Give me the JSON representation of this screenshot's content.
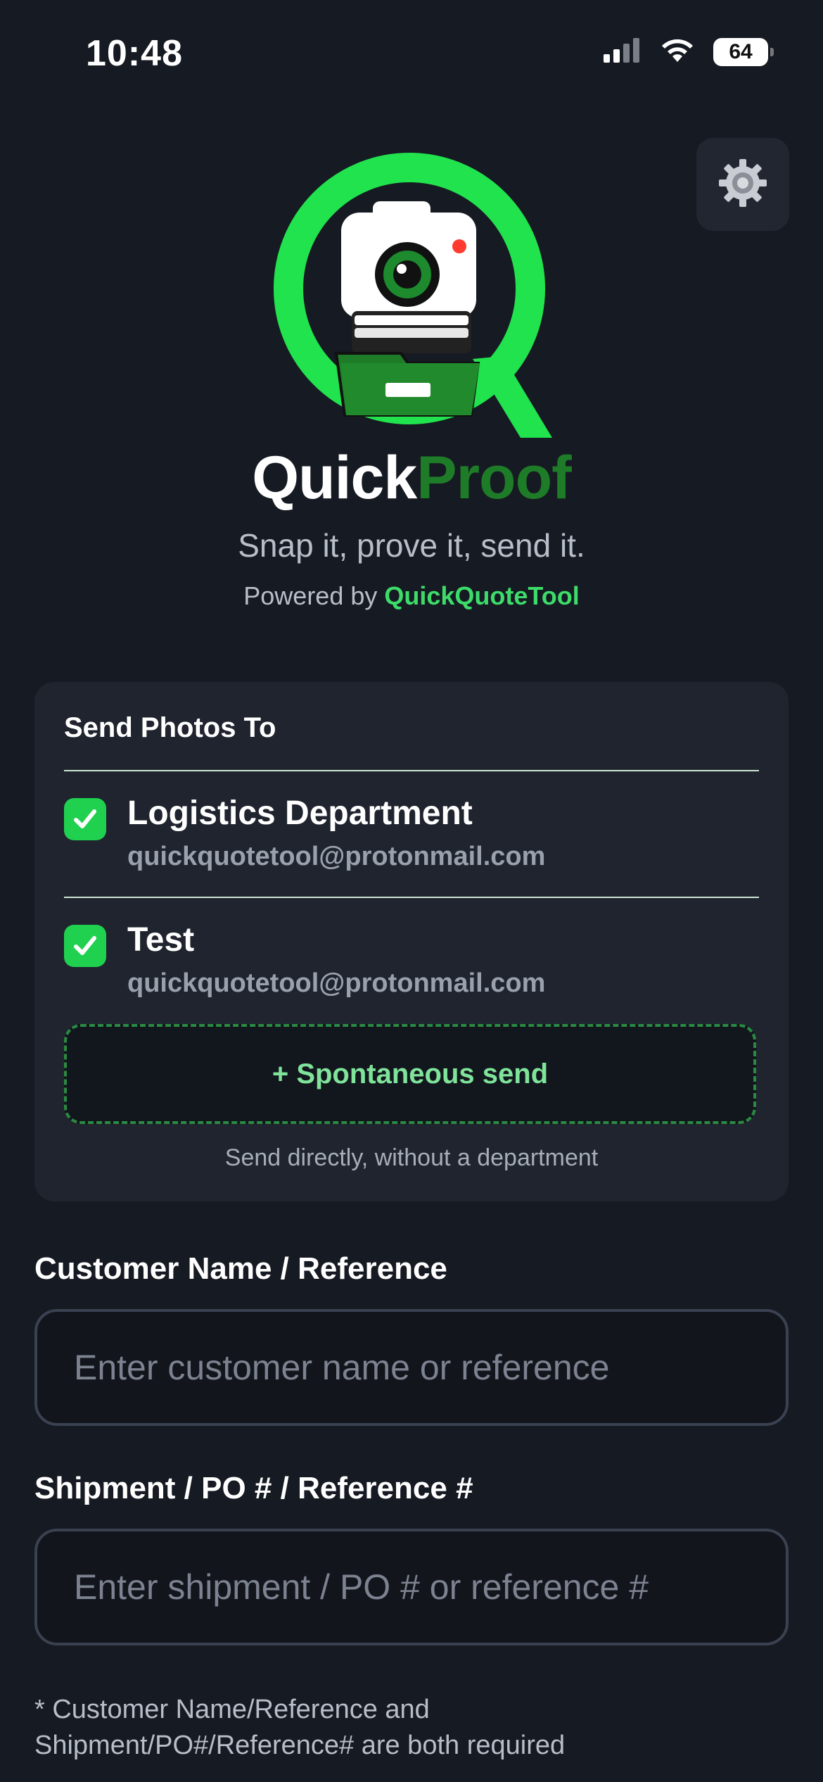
{
  "status_bar": {
    "time": "10:48",
    "battery": "64",
    "icons": [
      "signal-icon",
      "wifi-icon",
      "battery-icon"
    ]
  },
  "header": {
    "settings_icon": "gear-icon",
    "brand_first": "Quick",
    "brand_second": "Proof",
    "tagline": "Snap it, prove it, send it.",
    "powered_prefix": "Powered by",
    "powered_brand": "QuickQuoteTool"
  },
  "colors": {
    "accent_green": "#1fd14f",
    "brand_dark_green": "#1e7b28",
    "link_green": "#3ddc6a",
    "background": "#161a22",
    "card": "#1f242e"
  },
  "send_card": {
    "title": "Send Photos To",
    "recipients": [
      {
        "name": "Logistics Department",
        "email": "quickquotetool@protonmail.com",
        "checked": true
      },
      {
        "name": "Test",
        "email": "quickquotetool@protonmail.com",
        "checked": true
      }
    ],
    "spontaneous_label": "+ Spontaneous send",
    "spontaneous_hint": "Send directly, without a department"
  },
  "form": {
    "customer_label": "Customer Name / Reference",
    "customer_placeholder": "Enter customer name or reference",
    "customer_value": "",
    "shipment_label": "Shipment / PO # / Reference #",
    "shipment_placeholder": "Enter shipment / PO # or reference #",
    "shipment_value": "",
    "footnote_line1": "* Customer Name/Reference and",
    "footnote_line2": "Shipment/PO#/Reference# are both required"
  }
}
